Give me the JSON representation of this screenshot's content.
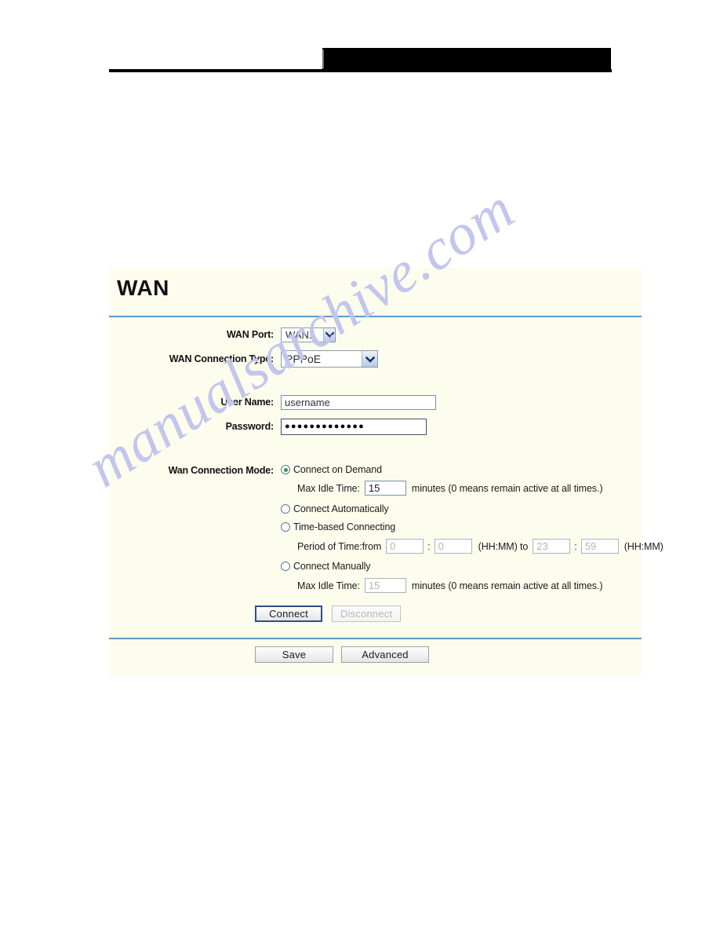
{
  "header": {
    "redaction_bar": "",
    "rule": ""
  },
  "watermark": {
    "text": "manualsarchive.com"
  },
  "panel": {
    "title": "WAN",
    "rows": {
      "wan_port_label": "WAN Port:",
      "wan_port_value": "WAN1",
      "wan_type_label": "WAN Connection Type:",
      "wan_type_value": "PPPoE",
      "username_label": "User Name:",
      "username_value": "username",
      "password_label": "Password:",
      "password_value": "●●●●●●●●●●●●●",
      "connection_mode_label": "Wan Connection Mode:"
    },
    "modes": [
      {
        "label": "Connect on Demand",
        "selected": true
      },
      {
        "label": "Connect Automatically",
        "selected": false
      },
      {
        "label": "Time-based Connecting",
        "selected": false
      },
      {
        "label": "Connect Manually",
        "selected": false
      }
    ],
    "idle_demand": {
      "label": "Max Idle Time:",
      "value": "15",
      "suffix": "minutes (0 means remain active at all times.)"
    },
    "period": {
      "label": "Period of Time:from",
      "from_hour": "0",
      "from_minute": "0",
      "format_1": "(HH:MM) to",
      "to_hour": "23",
      "to_minute": "59",
      "format_2": "(HH:MM)",
      "separator": ":"
    },
    "idle_manual": {
      "label": "Max Idle Time:",
      "value": "15",
      "suffix": "minutes (0 means remain active at all times.)"
    },
    "buttons": {
      "connect": "Connect",
      "disconnect": "Disconnect",
      "save": "Save",
      "advanced": "Advanced"
    }
  },
  "colors": {
    "panel_bg": "#fdfdee",
    "divider": "#5b9bc4",
    "radio_dot": "#2f9e3f",
    "watermark": "#c3c6ec"
  }
}
